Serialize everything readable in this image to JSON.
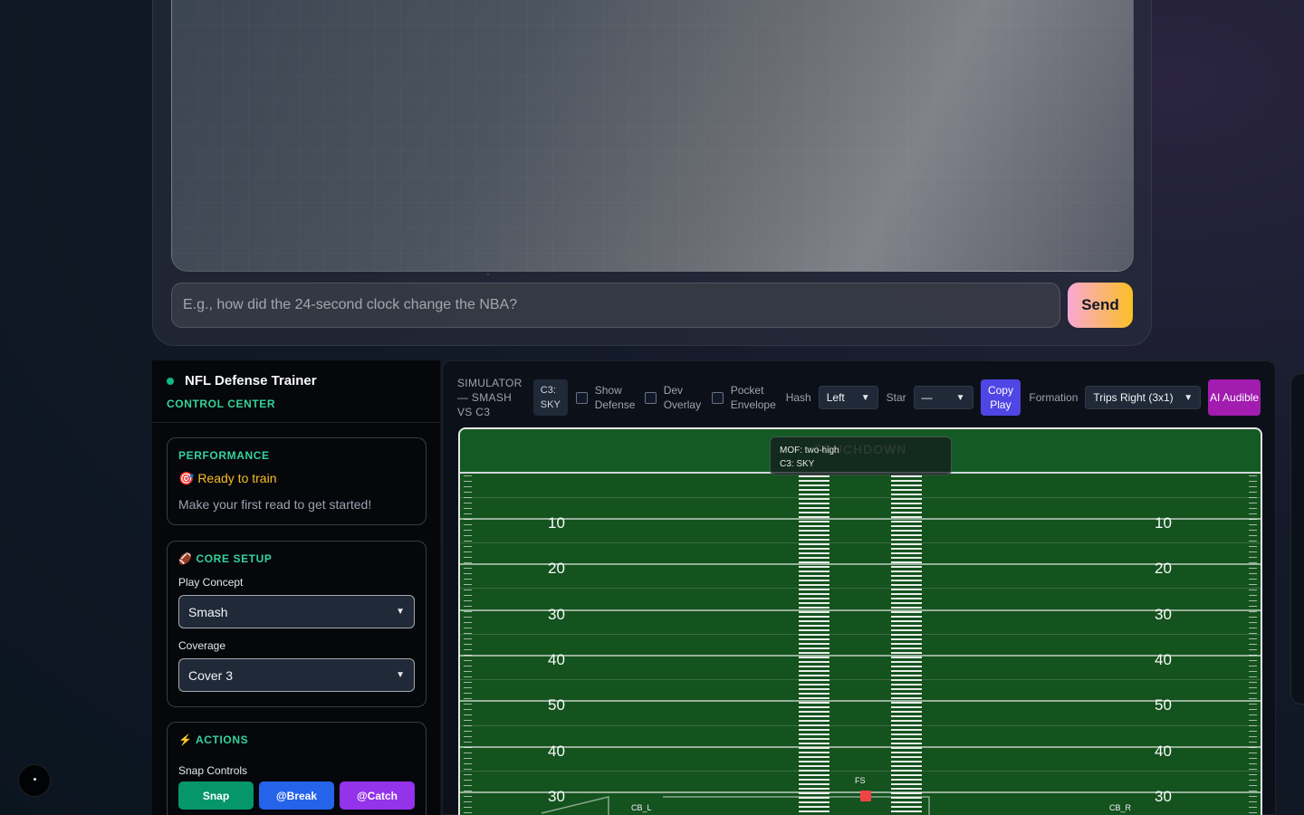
{
  "chat": {
    "input_placeholder": "E.g., how did the 24-second clock change the NBA?",
    "send_label": "Send"
  },
  "sidebar": {
    "title": "NFL Defense Trainer",
    "subtitle": "CONTROL CENTER",
    "performance": {
      "title": "PERFORMANCE",
      "status": "🎯 Ready to train",
      "description": "Make your first read to get started!"
    },
    "core_setup": {
      "title": "🏈 CORE SETUP",
      "play_concept_label": "Play Concept",
      "play_concept_value": "Smash",
      "coverage_label": "Coverage",
      "coverage_value": "Cover 3"
    },
    "actions": {
      "title": "⚡ ACTIONS",
      "snap_controls_label": "Snap Controls",
      "buttons": [
        "Snap",
        "@Break",
        "@Catch"
      ]
    }
  },
  "simulator": {
    "title": "SIMULATOR — SMASH VS C3",
    "badge": "C3: SKY",
    "checkboxes": [
      "Show Defense",
      "Dev Overlay",
      "Pocket Envelope"
    ],
    "hash_label": "Hash",
    "hash_value": "Left",
    "star_label": "Star",
    "star_value": "—",
    "copy_play_label": "Copy Play",
    "formation_label": "Formation",
    "formation_value": "Trips Right (3x1)",
    "ai_audible_label": "AI Audible",
    "field": {
      "endzone_text": "TOUCHDOWN",
      "overlay_lines": [
        "MOF: two-high",
        "C3: SKY"
      ],
      "yard_numbers": [
        "10",
        "20",
        "30",
        "40",
        "50",
        "40",
        "30"
      ],
      "players": [
        "FS",
        "CB_L",
        "CB_R"
      ]
    }
  },
  "colors": {
    "accent_green": "#34d399",
    "status_yellow": "#fbbf24",
    "snap_button": "#059669",
    "break_button": "#2563eb",
    "catch_button": "#9333ea",
    "copy_play_button": "#4f46e5",
    "ai_audible_button": "#a21caf",
    "field_green": "#14521e",
    "marker_red": "#ef4444"
  }
}
